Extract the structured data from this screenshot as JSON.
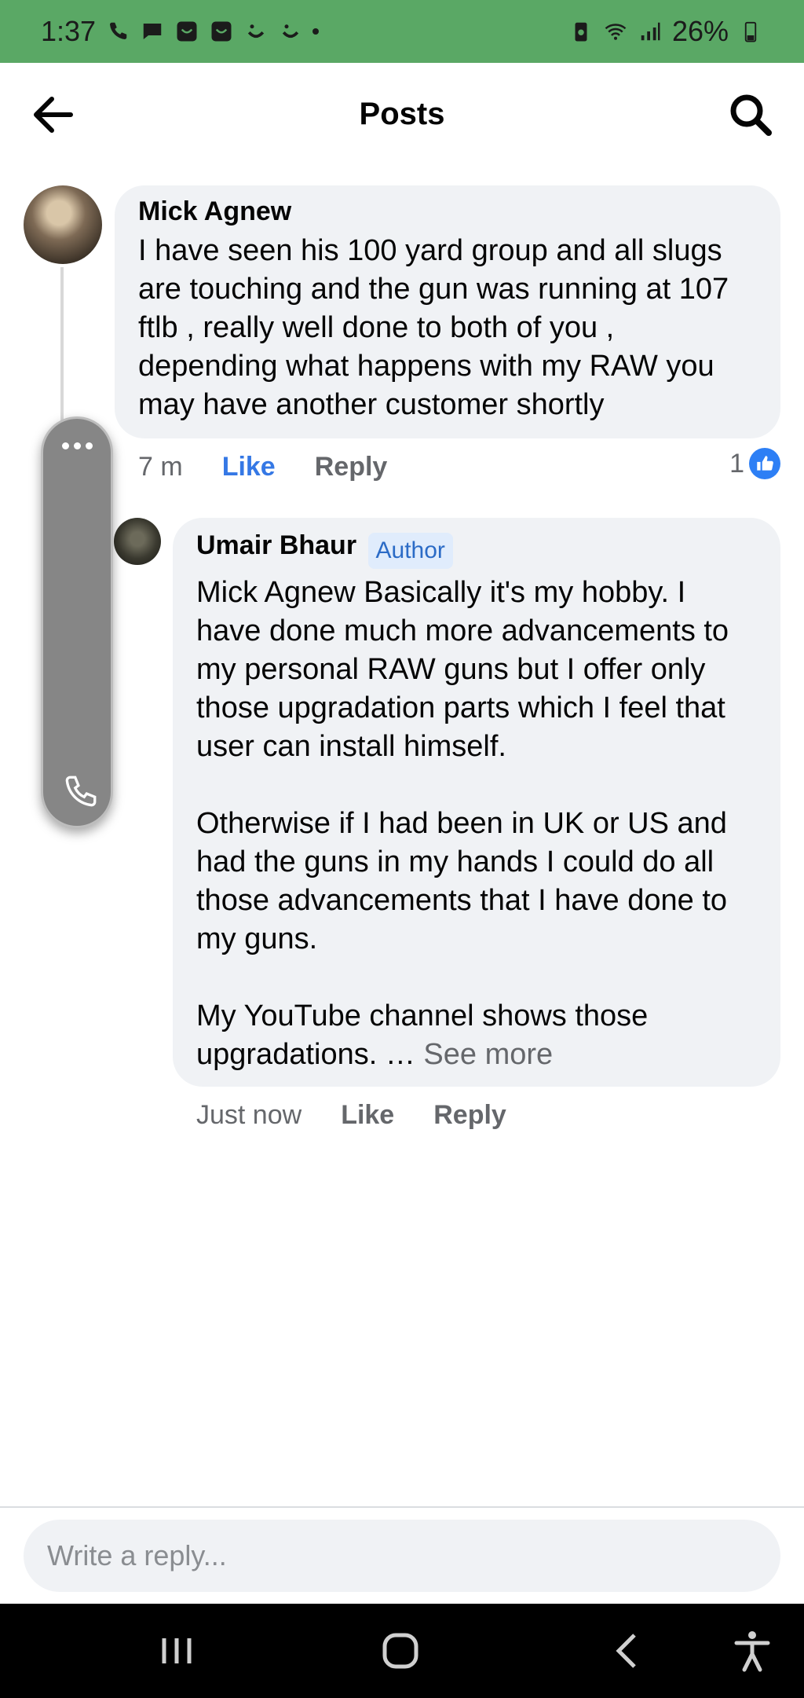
{
  "status_bar": {
    "time": "1:37",
    "battery": "26%",
    "left_icons": [
      "phone-icon",
      "message-icon",
      "app-icon",
      "app-icon",
      "emoji-icon",
      "emoji-icon",
      "dot-icon"
    ],
    "right_icons": [
      "battery-saver-icon",
      "wifi-icon",
      "signal-icon",
      "battery-icon"
    ]
  },
  "header": {
    "title": "Posts",
    "back_icon": "arrow-left-icon",
    "search_icon": "search-icon"
  },
  "comments": [
    {
      "author": "Mick Agnew",
      "text": "I have seen his 100 yard group and all slugs are touching and the gun was running at 107 ftlb , really well done to both of you , depending what happens with my RAW you may have another customer shortly",
      "time": "7 m",
      "like_label": "Like",
      "reply_label": "Reply",
      "reaction_count": "1",
      "liked": true
    },
    {
      "author": "Umair Bhaur",
      "badge": "Author",
      "text": "Mick Agnew Basically it's my hobby. I have done much more advancements to my personal RAW guns but I offer only those upgradation parts which I feel that user can install himself.\n\nOtherwise if I had been in UK or US and had the guns in my hands I could do all those advancements that I have done to my guns.\n\nMy YouTube channel shows those upgradations. …",
      "see_more": "See more",
      "time": "Just now",
      "like_label": "Like",
      "reply_label": "Reply"
    }
  ],
  "reply_box": {
    "placeholder": "Write a reply..."
  },
  "colors": {
    "status_bar": "#5aa865",
    "like_active": "#3578e5",
    "bubble": "#f0f2f5",
    "badge_bg": "#e0ecfc"
  }
}
